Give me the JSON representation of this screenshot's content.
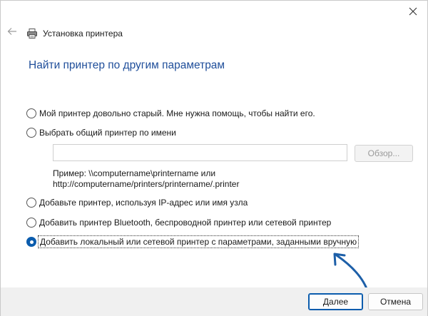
{
  "window": {
    "title": "Установка принтера",
    "close_icon": "close-icon",
    "back_icon": "back-arrow-icon",
    "title_icon": "printer-icon"
  },
  "main": {
    "heading": "Найти принтер по другим параметрам",
    "options": [
      {
        "label": "Мой принтер довольно старый. Мне нужна помощь, чтобы найти его.",
        "checked": false
      },
      {
        "label": "Выбрать общий принтер по имени",
        "checked": false
      },
      {
        "label": "Добавьте принтер, используя IP-адрес или имя узла",
        "checked": false
      },
      {
        "label": "Добавить принтер Bluetooth, беспроводной принтер или сетевой принтер",
        "checked": false
      },
      {
        "label": "Добавить локальный или сетевой принтер с параметрами, заданными вручную",
        "checked": true
      }
    ],
    "share_name_value": "",
    "browse_label": "Обзор...",
    "example_line1": "Пример: \\\\computername\\printername или",
    "example_line2": "http://computername/printers/printername/.printer"
  },
  "footer": {
    "next_label": "Далее",
    "cancel_label": "Отмена"
  },
  "colors": {
    "heading": "#1f4e9a",
    "accent": "#0b5cad",
    "annotation_arrow": "#1d5fa8"
  }
}
